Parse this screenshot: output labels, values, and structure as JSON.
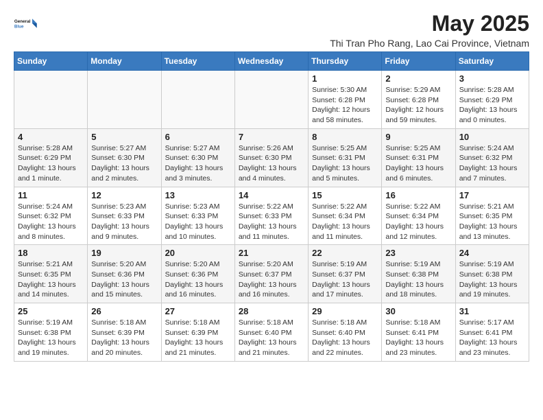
{
  "header": {
    "logo_line1": "General",
    "logo_line2": "Blue",
    "month_title": "May 2025",
    "location": "Thi Tran Pho Rang, Lao Cai Province, Vietnam"
  },
  "days_of_week": [
    "Sunday",
    "Monday",
    "Tuesday",
    "Wednesday",
    "Thursday",
    "Friday",
    "Saturday"
  ],
  "weeks": [
    [
      {
        "day": "",
        "info": ""
      },
      {
        "day": "",
        "info": ""
      },
      {
        "day": "",
        "info": ""
      },
      {
        "day": "",
        "info": ""
      },
      {
        "day": "1",
        "info": "Sunrise: 5:30 AM\nSunset: 6:28 PM\nDaylight: 12 hours\nand 58 minutes."
      },
      {
        "day": "2",
        "info": "Sunrise: 5:29 AM\nSunset: 6:28 PM\nDaylight: 12 hours\nand 59 minutes."
      },
      {
        "day": "3",
        "info": "Sunrise: 5:28 AM\nSunset: 6:29 PM\nDaylight: 13 hours\nand 0 minutes."
      }
    ],
    [
      {
        "day": "4",
        "info": "Sunrise: 5:28 AM\nSunset: 6:29 PM\nDaylight: 13 hours\nand 1 minute."
      },
      {
        "day": "5",
        "info": "Sunrise: 5:27 AM\nSunset: 6:30 PM\nDaylight: 13 hours\nand 2 minutes."
      },
      {
        "day": "6",
        "info": "Sunrise: 5:27 AM\nSunset: 6:30 PM\nDaylight: 13 hours\nand 3 minutes."
      },
      {
        "day": "7",
        "info": "Sunrise: 5:26 AM\nSunset: 6:30 PM\nDaylight: 13 hours\nand 4 minutes."
      },
      {
        "day": "8",
        "info": "Sunrise: 5:25 AM\nSunset: 6:31 PM\nDaylight: 13 hours\nand 5 minutes."
      },
      {
        "day": "9",
        "info": "Sunrise: 5:25 AM\nSunset: 6:31 PM\nDaylight: 13 hours\nand 6 minutes."
      },
      {
        "day": "10",
        "info": "Sunrise: 5:24 AM\nSunset: 6:32 PM\nDaylight: 13 hours\nand 7 minutes."
      }
    ],
    [
      {
        "day": "11",
        "info": "Sunrise: 5:24 AM\nSunset: 6:32 PM\nDaylight: 13 hours\nand 8 minutes."
      },
      {
        "day": "12",
        "info": "Sunrise: 5:23 AM\nSunset: 6:33 PM\nDaylight: 13 hours\nand 9 minutes."
      },
      {
        "day": "13",
        "info": "Sunrise: 5:23 AM\nSunset: 6:33 PM\nDaylight: 13 hours\nand 10 minutes."
      },
      {
        "day": "14",
        "info": "Sunrise: 5:22 AM\nSunset: 6:33 PM\nDaylight: 13 hours\nand 11 minutes."
      },
      {
        "day": "15",
        "info": "Sunrise: 5:22 AM\nSunset: 6:34 PM\nDaylight: 13 hours\nand 11 minutes."
      },
      {
        "day": "16",
        "info": "Sunrise: 5:22 AM\nSunset: 6:34 PM\nDaylight: 13 hours\nand 12 minutes."
      },
      {
        "day": "17",
        "info": "Sunrise: 5:21 AM\nSunset: 6:35 PM\nDaylight: 13 hours\nand 13 minutes."
      }
    ],
    [
      {
        "day": "18",
        "info": "Sunrise: 5:21 AM\nSunset: 6:35 PM\nDaylight: 13 hours\nand 14 minutes."
      },
      {
        "day": "19",
        "info": "Sunrise: 5:20 AM\nSunset: 6:36 PM\nDaylight: 13 hours\nand 15 minutes."
      },
      {
        "day": "20",
        "info": "Sunrise: 5:20 AM\nSunset: 6:36 PM\nDaylight: 13 hours\nand 16 minutes."
      },
      {
        "day": "21",
        "info": "Sunrise: 5:20 AM\nSunset: 6:37 PM\nDaylight: 13 hours\nand 16 minutes."
      },
      {
        "day": "22",
        "info": "Sunrise: 5:19 AM\nSunset: 6:37 PM\nDaylight: 13 hours\nand 17 minutes."
      },
      {
        "day": "23",
        "info": "Sunrise: 5:19 AM\nSunset: 6:38 PM\nDaylight: 13 hours\nand 18 minutes."
      },
      {
        "day": "24",
        "info": "Sunrise: 5:19 AM\nSunset: 6:38 PM\nDaylight: 13 hours\nand 19 minutes."
      }
    ],
    [
      {
        "day": "25",
        "info": "Sunrise: 5:19 AM\nSunset: 6:38 PM\nDaylight: 13 hours\nand 19 minutes."
      },
      {
        "day": "26",
        "info": "Sunrise: 5:18 AM\nSunset: 6:39 PM\nDaylight: 13 hours\nand 20 minutes."
      },
      {
        "day": "27",
        "info": "Sunrise: 5:18 AM\nSunset: 6:39 PM\nDaylight: 13 hours\nand 21 minutes."
      },
      {
        "day": "28",
        "info": "Sunrise: 5:18 AM\nSunset: 6:40 PM\nDaylight: 13 hours\nand 21 minutes."
      },
      {
        "day": "29",
        "info": "Sunrise: 5:18 AM\nSunset: 6:40 PM\nDaylight: 13 hours\nand 22 minutes."
      },
      {
        "day": "30",
        "info": "Sunrise: 5:18 AM\nSunset: 6:41 PM\nDaylight: 13 hours\nand 23 minutes."
      },
      {
        "day": "31",
        "info": "Sunrise: 5:17 AM\nSunset: 6:41 PM\nDaylight: 13 hours\nand 23 minutes."
      }
    ]
  ]
}
